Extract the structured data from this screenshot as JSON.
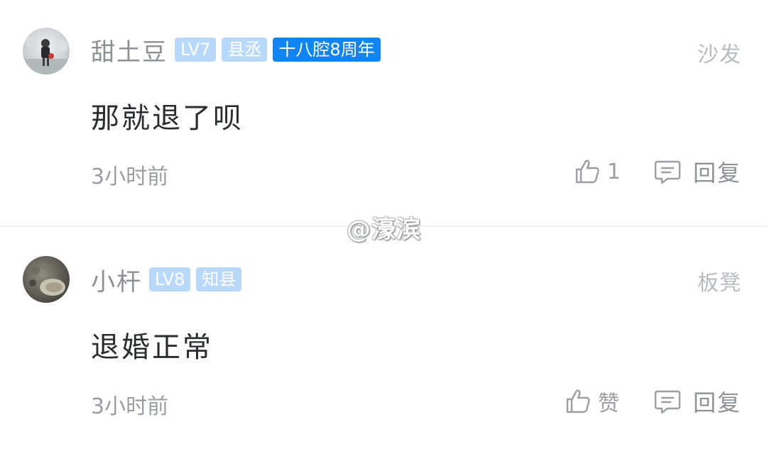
{
  "comments": [
    {
      "username": "甜土豆",
      "badges": [
        "LV7",
        "县丞",
        "十八腔8周年"
      ],
      "floor": "沙发",
      "content": "那就退了呗",
      "time": "3小时前",
      "like_label": "1",
      "reply_label": "回复",
      "avatar_icon": "user-photo-avatar"
    },
    {
      "username": "小杆",
      "badges": [
        "LV8",
        "知县"
      ],
      "floor": "板凳",
      "content": "退婚正常",
      "time": "3小时前",
      "like_label": "赞",
      "reply_label": "回复",
      "avatar_icon": "user-photo-avatar"
    }
  ],
  "watermark": "@濠滨",
  "colors": {
    "badge_light": "#b8d9fb",
    "badge_solid": "#0f84f2",
    "username": "#8e9096",
    "content": "#2b2c30",
    "meta": "#9b9da2"
  },
  "icons": {
    "like": "thumbs-up-icon",
    "reply": "comment-bubble-icon"
  }
}
